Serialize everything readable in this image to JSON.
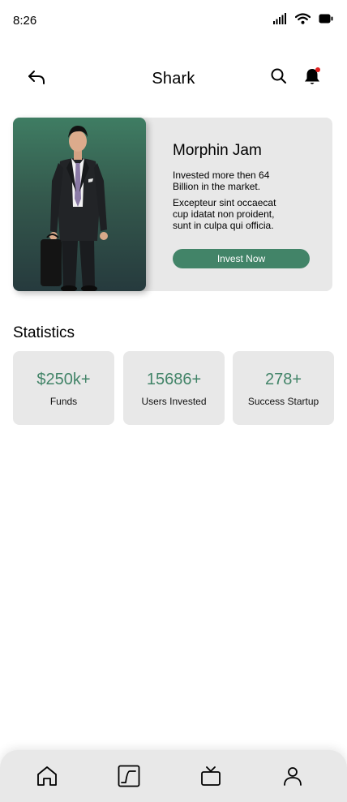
{
  "status_bar": {
    "time": "8:26",
    "icons": [
      "signal-icon",
      "wifi-icon",
      "battery-icon"
    ]
  },
  "header": {
    "title": "Shark",
    "back_icon": "back-arrow-icon",
    "search_icon": "search-icon",
    "bell_icon": "bell-icon",
    "has_notification": true
  },
  "profile": {
    "name": "Morphin Jam",
    "description": "Invested more then 64 Billion in the market.",
    "description2": "Excepteur sint occaecat cup idatat non proident, sunt in  culpa qui officia.",
    "button_label": "Invest Now",
    "photo": "man-in-suit-with-briefcase"
  },
  "statistics": {
    "title": "Statistics",
    "items": [
      {
        "value": "$250k+",
        "label": "Funds"
      },
      {
        "value": "15686+",
        "label": "Users Invested"
      },
      {
        "value": "278+",
        "label": "Success Startup"
      }
    ]
  },
  "bottom_nav": {
    "items": [
      {
        "icon": "home-icon"
      },
      {
        "icon": "chart-icon"
      },
      {
        "icon": "tv-icon"
      },
      {
        "icon": "profile-icon"
      }
    ]
  },
  "colors": {
    "accent": "#428468",
    "notification": "#e02020",
    "card_background": "#e8e8e8"
  }
}
